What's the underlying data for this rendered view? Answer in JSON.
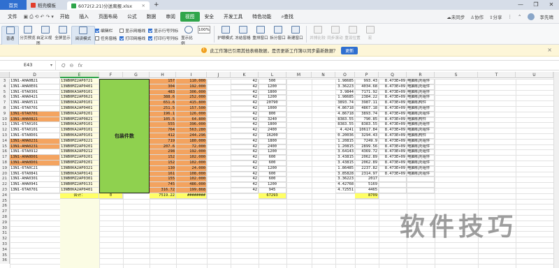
{
  "tabs": {
    "home": "首页",
    "templates": "稻壳模板",
    "file": "6072(2.21)分送离报.xlsx"
  },
  "window": {
    "min": "—",
    "max": "❐",
    "close": "✕"
  },
  "menu": {
    "file": "文件",
    "items": [
      "开始",
      "插入",
      "页面布局",
      "公式",
      "数据",
      "审阅",
      "视图",
      "安全",
      "开发工具",
      "特色功能"
    ],
    "active_index": 6,
    "search": "查找",
    "right": {
      "sync": "未同步",
      "collab": "协作",
      "share": "分享",
      "user": "李先晴"
    }
  },
  "toolbar": {
    "buttons1": [
      "普通",
      "分页预览",
      "自定义视图",
      "全屏显示",
      "阅读模式"
    ],
    "checks1": [
      {
        "label": "编辑栏",
        "on": true
      },
      {
        "label": "任务窗格",
        "on": false
      }
    ],
    "checks2": [
      {
        "label": "显示网格线",
        "on": false
      },
      {
        "label": "打印网格线",
        "on": true
      }
    ],
    "checks3": [
      {
        "label": "显示行号列标",
        "on": true
      },
      {
        "label": "打印行号列标",
        "on": true
      }
    ],
    "zoom_label": "显示比例",
    "zoom_value": "100%",
    "buttons2": [
      "护眼模式",
      "冻结窗格",
      "重排窗口",
      "拆分窗口",
      "新建窗口"
    ],
    "buttons3": [
      "并排比较",
      "同步滚动",
      "重设位置",
      "宏"
    ]
  },
  "notice": {
    "text": "此工作簿已引用其他表格数据，是否更新工作簿以同步最新数据？",
    "button": "更新",
    "close": "×"
  },
  "formula_bar": {
    "cell": "E43",
    "fx": "fx",
    "icons": [
      "Q",
      "⊖"
    ]
  },
  "grid": {
    "columns": [
      "D",
      "E",
      "F",
      "G",
      "H",
      "I",
      "J",
      "K",
      "L",
      "M",
      "N",
      "O",
      "P",
      "Q",
      "R",
      "S",
      "T",
      "U"
    ],
    "selected_column": "E",
    "row_numbers": [
      3,
      4,
      5,
      6,
      7,
      8,
      9,
      10,
      11,
      12,
      13,
      14,
      15,
      16,
      17,
      18,
      19,
      20,
      21,
      22,
      23,
      24,
      25,
      26,
      27,
      28,
      29,
      30,
      31,
      32,
      33,
      34,
      35,
      36
    ],
    "merged_label": "包装件数",
    "total_label": "合计：",
    "total_f": "0",
    "total_h": "7519.22",
    "total_i": "########",
    "total_l": "67293",
    "total_q": "8709",
    "rows": [
      [
        "13N1-AHA0B21",
        "13NB0MZ2AP0721",
        "157",
        "110.000",
        "42",
        "500",
        "1.98685",
        "993.43",
        "8.473E+09",
        "电脑机壳组件"
      ],
      [
        "13N1-AHA0E01",
        "13NB0MZ2AP0401",
        "304",
        "192.000",
        "42",
        "1200",
        "3.36223",
        "4034.68",
        "8.473E+09",
        "电脑机壳组件"
      ],
      [
        "13N1-6TA0301",
        "13NB0KA3AP0101",
        "483",
        "306.000",
        "42",
        "1800",
        "3.9844",
        "7171.92",
        "8.473E+09",
        "电脑机壳组件"
      ],
      [
        "13N1-AHA0421",
        "13NB0MZ2AP0621",
        "388.6",
        "252.000",
        "42",
        "1200",
        "1.98685",
        "2384.22",
        "8.473E+09",
        "电脑机壳组件"
      ],
      [
        "13N1-AHA0511",
        "13NB0KA2AP0101",
        "651.6",
        "415.800",
        "42",
        "20790",
        "3893.74",
        "3987.11",
        "8.473E+09",
        "电脑机构件"
      ],
      [
        "13N1-6TA0701",
        "13NB0KA2AP0401",
        "251.5",
        "157.500",
        "42",
        "1000",
        "4.86718",
        "4867.18",
        "8.473E+09",
        "电脑机壳组件"
      ],
      [
        "13N1-6TA0701",
        "13NB0KA2AP0201",
        "196.1",
        "126.000",
        "42",
        "800",
        "4.86718",
        "3893.74",
        "8.473E+09",
        "电脑机壳组件"
      ],
      [
        "13N1-AHA0821",
        "13NB0MZ2AP0821",
        "105.5",
        "64.800",
        "42",
        "3240",
        "8383.55",
        "790.85",
        "8.473E+09",
        "电脑机构件"
      ],
      [
        "13N1-6TA0101",
        "13NB0KA2AP0101",
        "555",
        "396.000",
        "42",
        "1800",
        "8383.55",
        "8383.55",
        "8.473E+09",
        "电脑机壳组件"
      ],
      [
        "13N1-6TA0101",
        "13NB0KA2AP0101",
        "764",
        "563.280",
        "42",
        "2400",
        "4.4241",
        "10617.84",
        "8.473E+09",
        "电脑机壳组件"
      ],
      [
        "13N1-6TA0D01",
        "13NB0KA2AP0101",
        "412",
        "244.296",
        "42",
        "16200",
        "0.20036",
        "3294.43",
        "8.473E+09",
        "电脑机构件"
      ],
      [
        "13N1-AHA0231",
        "13NB0MZ2AP0221",
        "719",
        "180.000",
        "42",
        "1800",
        "1.20815",
        "7249.9",
        "8.473E+09",
        "电脑机壳组件"
      ],
      [
        "13N1-AHA0231",
        "13NB0MZ2AP0201",
        "207.6",
        "72.000",
        "42",
        "2400",
        "1.20815",
        "2899.56",
        "8.473E+09",
        "电脑机壳组件"
      ],
      [
        "13N1-6TA0912",
        "13NB0KA2AP0212",
        "298",
        "192.000",
        "42",
        "1200",
        "3.64143",
        "4369.72",
        "8.473E+09",
        "电脑机壳组件"
      ],
      [
        "13N1-AHA0D01",
        "13NB0MZ2AP0201",
        "152",
        "102.000",
        "42",
        "600",
        "3.43815",
        "2062.89",
        "8.473E+09",
        "电脑机壳组件"
      ],
      [
        "13N1-AHA0D01",
        "13NB0MZ2AP0201",
        "152",
        "102.000",
        "42",
        "600",
        "3.43815",
        "2062.89",
        "8.473E+09",
        "电脑机壳组件"
      ],
      [
        "13N1-6TA0C21",
        "13NB0KA2AP0321",
        "130",
        "24.000",
        "42",
        "1200",
        "1.86485",
        "2237.82",
        "8.473E+09",
        "电脑机壳组件"
      ],
      [
        "13N1-6TA0841",
        "13NB0KA3AP0141",
        "161",
        "108.000",
        "42",
        "600",
        "3.85828",
        "2314.97",
        "8.473E+09",
        "电脑机壳组件"
      ],
      [
        "13N1-AHA0301",
        "13NB0MZ2AP0301",
        "155",
        "102.000",
        "42",
        "600",
        "3.36223",
        "2017",
        "",
        ""
      ],
      [
        "13N1-AHA0941",
        "13NB0MZ2AP0131",
        "745",
        "486.000",
        "42",
        "1200",
        "4.42768",
        "5169",
        "",
        ""
      ],
      [
        "13N1-6TA0701",
        "13NB0KA2AP0401",
        "316.72",
        "199.868",
        "42",
        "945",
        "4.72551",
        "4465",
        "",
        ""
      ]
    ]
  },
  "watermark": "软件技巧"
}
